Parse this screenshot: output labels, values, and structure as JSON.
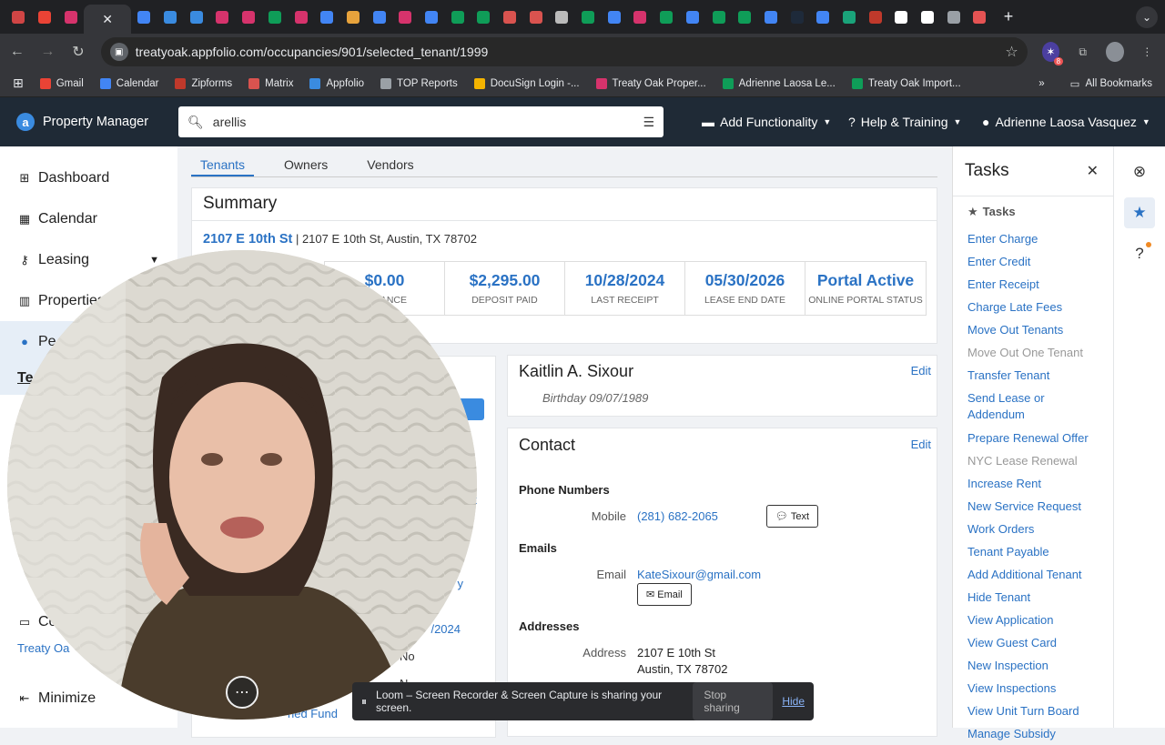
{
  "browser": {
    "url": "treatyoak.appfolio.com/occupancies/901/selected_tenant/1999",
    "tabs": [
      {
        "icon": "record-icon",
        "color": "#d04545"
      },
      {
        "icon": "gmail-icon",
        "color": "#ea4335"
      },
      {
        "icon": "zipforms-icon",
        "color": "#d6336c"
      },
      {
        "icon": "close-tab-icon",
        "color": "#35363a"
      },
      {
        "icon": "doc-icon",
        "color": "#4285f4"
      },
      {
        "icon": "appfolio-icon",
        "color": "#3a8be0"
      },
      {
        "icon": "appfolio-icon",
        "color": "#3a8be0"
      },
      {
        "icon": "zipforms-icon",
        "color": "#d6336c"
      },
      {
        "icon": "zipforms-icon",
        "color": "#d6336c"
      },
      {
        "icon": "sheets-icon",
        "color": "#0f9d58"
      },
      {
        "icon": "zipforms-icon",
        "color": "#d6336c"
      },
      {
        "icon": "docs-icon",
        "color": "#4285f4"
      },
      {
        "icon": "stack-icon",
        "color": "#e8a33c"
      },
      {
        "icon": "docs-icon",
        "color": "#4285f4"
      },
      {
        "icon": "zipforms-icon",
        "color": "#d6336c"
      },
      {
        "icon": "docs-icon",
        "color": "#4285f4"
      },
      {
        "icon": "plus-icon",
        "color": "#0f9d58"
      },
      {
        "icon": "sheets-icon",
        "color": "#0f9d58"
      },
      {
        "icon": "matrix-icon",
        "color": "#d9534f"
      },
      {
        "icon": "matrix-icon",
        "color": "#d9534f"
      },
      {
        "icon": "openai-icon",
        "color": "#bbbbbb"
      },
      {
        "icon": "sheets-icon",
        "color": "#0f9d58"
      },
      {
        "icon": "docs-icon",
        "color": "#4285f4"
      },
      {
        "icon": "zipforms-icon",
        "color": "#d6336c"
      },
      {
        "icon": "sheets-icon",
        "color": "#0f9d58"
      },
      {
        "icon": "docs-icon",
        "color": "#4285f4"
      },
      {
        "icon": "sheets-icon",
        "color": "#0f9d58"
      },
      {
        "icon": "sheets-icon",
        "color": "#0f9d58"
      },
      {
        "icon": "docs-icon",
        "color": "#4285f4"
      },
      {
        "icon": "blank-icon",
        "color": "#1e2a3a"
      },
      {
        "icon": "docs-icon",
        "color": "#4285f4"
      },
      {
        "icon": "send-icon",
        "color": "#1aa37a"
      },
      {
        "icon": "red-icon",
        "color": "#c0392b"
      },
      {
        "icon": "circle-icon",
        "color": "#ffffff"
      },
      {
        "icon": "circle-icon",
        "color": "#ffffff"
      },
      {
        "icon": "globe-icon",
        "color": "#9aa0a6"
      },
      {
        "icon": "gear-icon",
        "color": "#e55353"
      }
    ],
    "bookmarks": [
      {
        "label": "Gmail",
        "color": "#ea4335"
      },
      {
        "label": "Calendar",
        "color": "#4285f4"
      },
      {
        "label": "Zipforms",
        "color": "#c0392b"
      },
      {
        "label": "Matrix",
        "color": "#d9534f"
      },
      {
        "label": "Appfolio",
        "color": "#3a8be0"
      },
      {
        "label": "TOP Reports",
        "color": "#9aa0a6"
      },
      {
        "label": "DocuSign Login -...",
        "color": "#f4b400"
      },
      {
        "label": "Treaty Oak Proper...",
        "color": "#d6336c"
      },
      {
        "label": "Adrienne Laosa Le...",
        "color": "#0f9d58"
      },
      {
        "label": "Treaty Oak Import...",
        "color": "#0f9d58"
      }
    ],
    "more_bookmarks": "»",
    "all_bookmarks": "All Bookmarks",
    "ext_badge": "8"
  },
  "header": {
    "app_name": "Property Manager",
    "search_value": "arellis",
    "add_functionality": "Add Functionality",
    "help": "Help & Training",
    "user": "Adrienne Laosa Vasquez"
  },
  "sidebar": {
    "items": [
      {
        "label": "Dashboard",
        "icon": "grid-icon"
      },
      {
        "label": "Calendar",
        "icon": "calendar-icon"
      },
      {
        "label": "Leasing",
        "icon": "key-icon"
      },
      {
        "label": "Properties",
        "icon": "building-icon"
      },
      {
        "label": "Pe",
        "icon": "person-icon"
      }
    ],
    "sub_active": "Te",
    "inbox_label": "Co",
    "company": "Treaty Oa",
    "minimize": "Minimize"
  },
  "tabs": [
    "Tenants",
    "Owners",
    "Vendors"
  ],
  "summary": {
    "title": "Summary",
    "property_link": "2107 E 10th St",
    "property_address": "2107 E 10th St, Austin, TX 78702",
    "stats": [
      {
        "value": "$0.00",
        "label": "BALANCE"
      },
      {
        "value": "$2,295.00",
        "label": "DEPOSIT PAID"
      },
      {
        "value": "10/28/2024",
        "label": "LAST RECEIPT"
      },
      {
        "value": "05/30/2026",
        "label": "LEASE END DATE"
      },
      {
        "value": "Portal Active",
        "label": "ONLINE PORTAL STATUS"
      }
    ]
  },
  "left_col": {
    "link_fragment": "y",
    "date_fragment": "/2024",
    "text_no": "No",
    "text_n": "N",
    "fund_fragment": "ned Fund"
  },
  "tenant": {
    "name": "Kaitlin A. Sixour",
    "edit": "Edit",
    "birthday": "Birthday 09/07/1989"
  },
  "contact": {
    "title": "Contact",
    "edit": "Edit",
    "phone_header": "Phone Numbers",
    "phone_label": "Mobile",
    "phone": "(281) 682-2065",
    "text_btn": "Text",
    "emails_header": "Emails",
    "email_label": "Email",
    "email": "KateSixour@gmail.com",
    "email_btn": "Email",
    "addresses_header": "Addresses",
    "address_label": "Address",
    "address_line1": "2107 E 10th St",
    "address_line2": "Austin, TX 78702"
  },
  "tasks_panel": {
    "title": "Tasks",
    "subtitle": "Tasks",
    "items": [
      {
        "label": "Enter Charge",
        "dim": false
      },
      {
        "label": "Enter Credit",
        "dim": false
      },
      {
        "label": "Enter Receipt",
        "dim": false
      },
      {
        "label": "Charge Late Fees",
        "dim": false
      },
      {
        "label": "Move Out Tenants",
        "dim": false
      },
      {
        "label": "Move Out One Tenant",
        "dim": true
      },
      {
        "label": "Transfer Tenant",
        "dim": false
      },
      {
        "label": "Send Lease or Addendum",
        "dim": false
      },
      {
        "label": "Prepare Renewal Offer",
        "dim": false
      },
      {
        "label": "NYC Lease Renewal",
        "dim": true
      },
      {
        "label": "Increase Rent",
        "dim": false
      },
      {
        "label": "New Service Request",
        "dim": false
      },
      {
        "label": "Work Orders",
        "dim": false
      },
      {
        "label": "Tenant Payable",
        "dim": false
      },
      {
        "label": "Add Additional Tenant",
        "dim": false
      },
      {
        "label": "Hide Tenant",
        "dim": false
      },
      {
        "label": "View Application",
        "dim": false
      },
      {
        "label": "View Guest Card",
        "dim": false
      },
      {
        "label": "New Inspection",
        "dim": false
      },
      {
        "label": "View Inspections",
        "dim": false
      },
      {
        "label": "View Unit Turn Board",
        "dim": false
      },
      {
        "label": "Manage Subsidy",
        "dim": false
      }
    ]
  },
  "loom": {
    "message": "Loom – Screen Recorder & Screen Capture is sharing your screen.",
    "stop": "Stop sharing",
    "hide": "Hide"
  },
  "colors": {
    "accent": "#2a72c4",
    "header_bg": "#1f2a36",
    "chrome_bg": "#35363a"
  }
}
